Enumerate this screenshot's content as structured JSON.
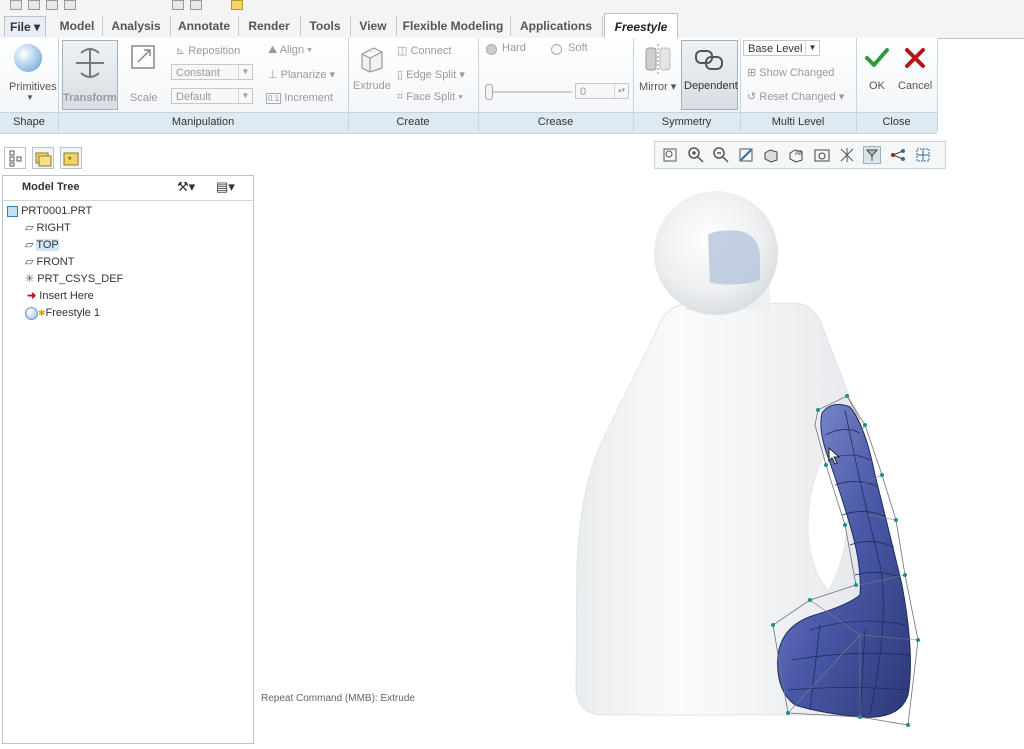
{
  "tabs": {
    "file": "File ▾",
    "model": "Model",
    "analysis": "Analysis",
    "annotate": "Annotate",
    "render": "Render",
    "tools": "Tools",
    "view": "View",
    "flexible": "Flexible Modeling",
    "applications": "Applications",
    "freestyle": "Freestyle"
  },
  "ribbon": {
    "primitives": "Primitives",
    "transform": "Transform",
    "scale": "Scale",
    "reposition": "Reposition",
    "constant": "Constant",
    "default": "Default",
    "align": "Align",
    "planarize": "Planarize",
    "increment": "Increment",
    "extrude": "Extrude",
    "connect": "Connect",
    "edge_split": "Edge Split",
    "face_split": "Face Split",
    "hard": "Hard",
    "soft": "Soft",
    "crease_value": "0",
    "mirror": "Mirror",
    "dependent": "Dependent",
    "base_level": "Base Level",
    "show_changed": "Show Changed",
    "reset_changed": "Reset Changed",
    "ok": "OK",
    "cancel": "Cancel"
  },
  "groups": {
    "shape": "Shape",
    "manipulation": "Manipulation",
    "create": "Create",
    "crease": "Crease",
    "symmetry": "Symmetry",
    "multi_level": "Multi Level",
    "close": "Close"
  },
  "tree": {
    "title": "Model Tree",
    "items": [
      "PRT0001.PRT",
      "RIGHT",
      "TOP",
      "FRONT",
      "PRT_CSYS_DEF",
      "Insert Here",
      "Freestyle 1"
    ],
    "selected": "TOP"
  },
  "status": "Repeat Command (MMB): Extrude",
  "colors": {
    "accent_tab": "#b8c3cc",
    "group_bar": "#dfe9f1",
    "selection": "#cfe6f7",
    "ok_green": "#2e9b3a",
    "cancel_red": "#b3161b",
    "mesh_blue": "#4a5aa8",
    "insert_red": "#b3161b"
  }
}
